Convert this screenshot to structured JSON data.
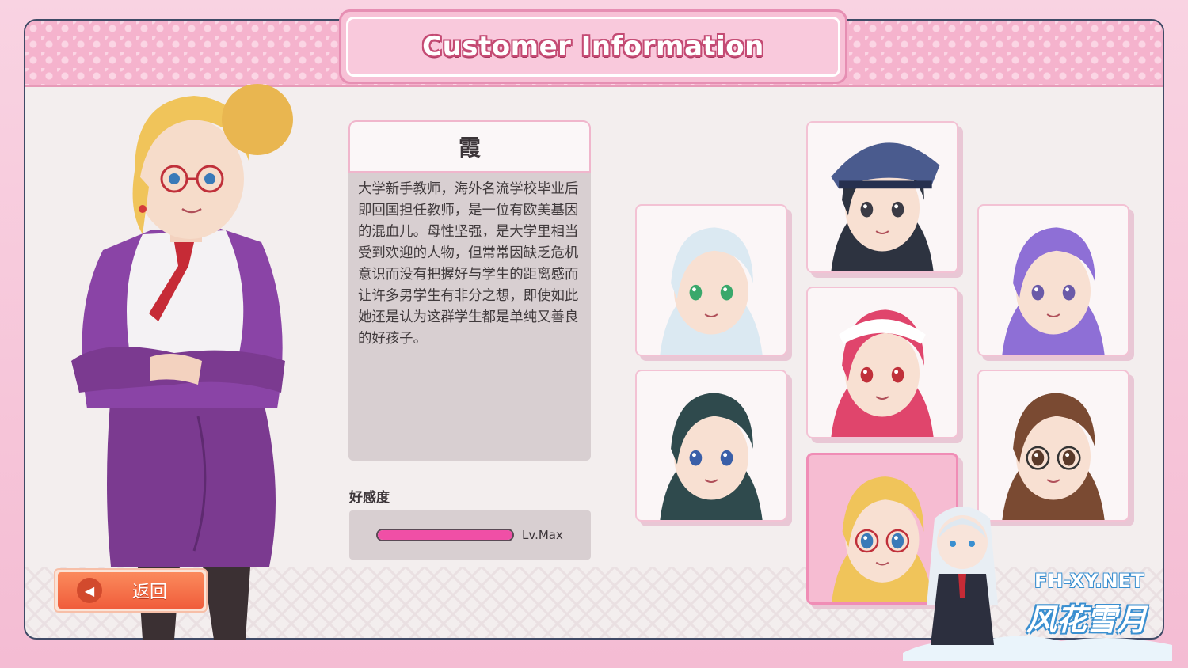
{
  "header": {
    "title": "Customer Information"
  },
  "character": {
    "name": "霞",
    "description": "大学新手教师，海外名流学校毕业后即回国担任教师，是一位有欧美基因的混血儿。母性坚强，是大学里相当受到欢迎的人物，但常常因缺乏危机意识而没有把握好与学生的距离感而让许多男学生有非分之想，即使如此她还是认为这群学生都是单纯又善良的好孩子。"
  },
  "affection": {
    "label": "好感度",
    "level_text": "Lv.Max",
    "fill_fraction": 1.0
  },
  "back_button": {
    "label": "返回"
  },
  "portraits": [
    {
      "id": "white-hair-ponytail",
      "hair": "#dbe9f2",
      "eyes": "#3aa86b",
      "selected": false
    },
    {
      "id": "police-officer",
      "hair": "#2d3340",
      "eyes": "#3b3b45",
      "selected": false
    },
    {
      "id": "purple-hair",
      "hair": "#8e6fd6",
      "eyes": "#6a5aa8",
      "selected": false
    },
    {
      "id": "dark-teal-hair",
      "hair": "#2f4a4d",
      "eyes": "#3a5fa8",
      "selected": false
    },
    {
      "id": "pink-maid",
      "hair": "#e0456c",
      "eyes": "#c0303a",
      "selected": false
    },
    {
      "id": "brown-glasses",
      "hair": "#7a4a32",
      "eyes": "#5a3a2a",
      "selected": false
    },
    {
      "id": "blonde-glasses",
      "hair": "#f0c45a",
      "eyes": "#3a7ab8",
      "selected": true
    }
  ],
  "watermark": {
    "url": "FH-XY.NET",
    "brand": "风花雪月"
  },
  "colors": {
    "accent_pink": "#f5b3cd",
    "bar_fill": "#f04fa6",
    "back_button": "#f05d3b"
  }
}
